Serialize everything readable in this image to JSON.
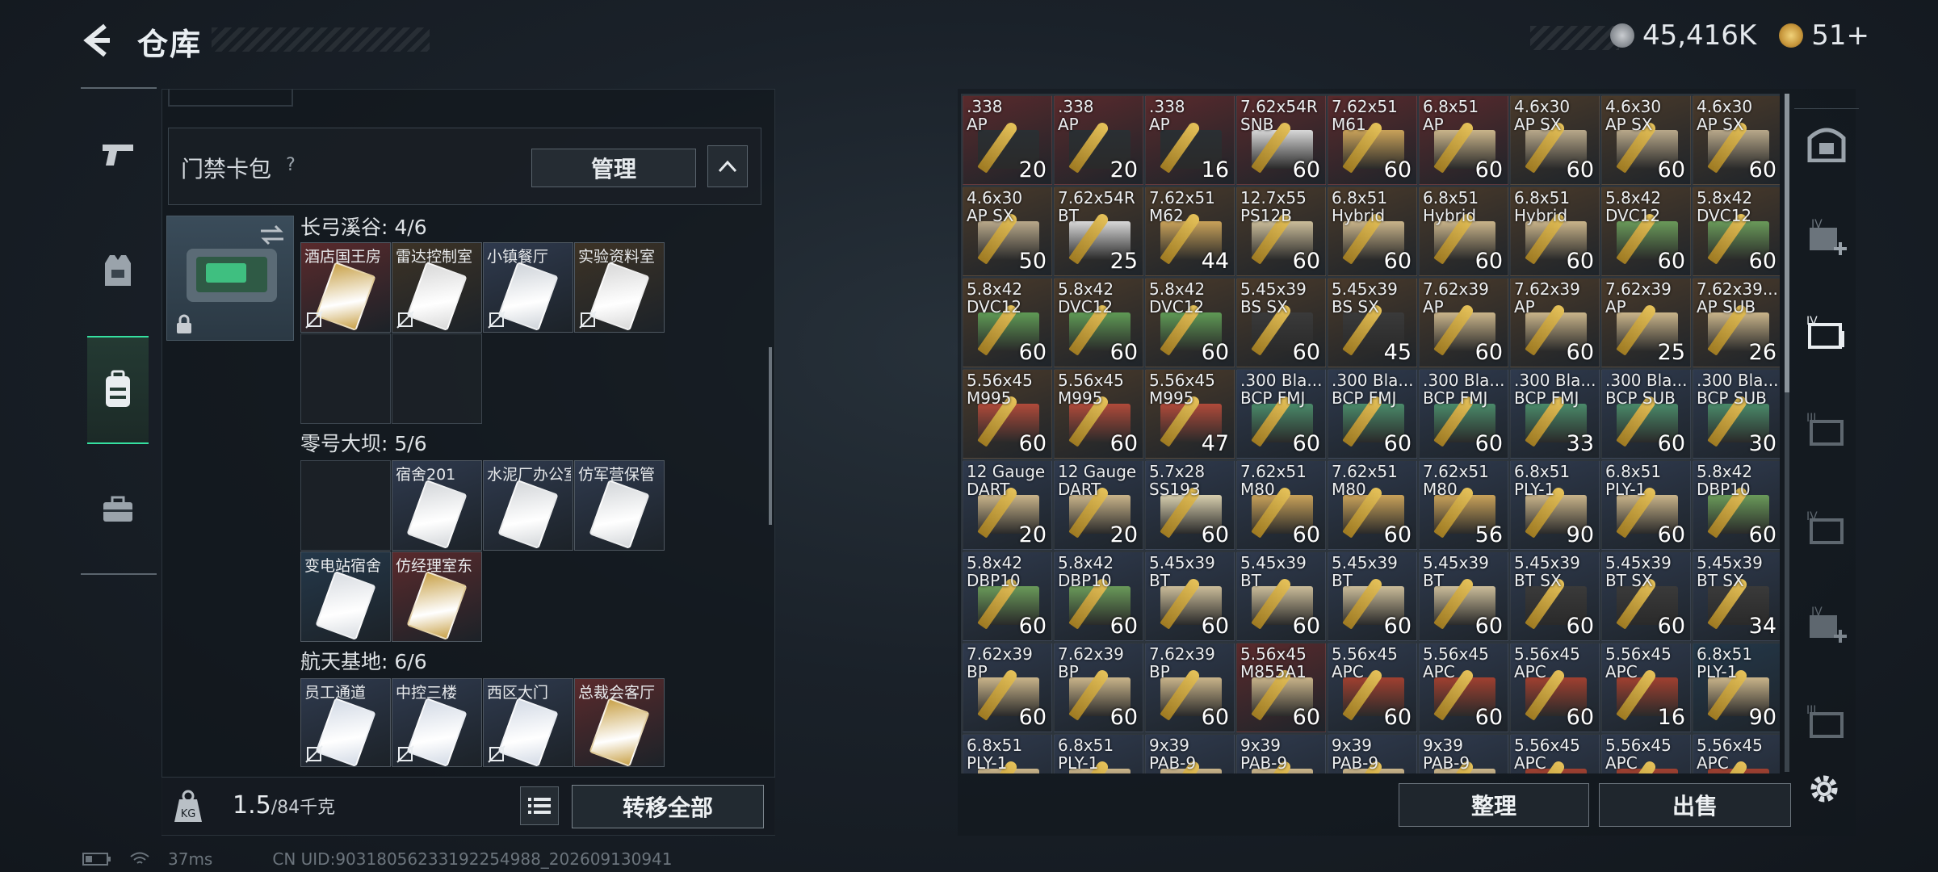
{
  "header": {
    "title": "仓库",
    "currency_silver": "45,416K",
    "currency_gold": "51+"
  },
  "left": {
    "access_label": "门禁卡包",
    "help": "?",
    "manage": "管理",
    "sections": [
      {
        "title": "长弓溪谷: 4/6",
        "keys": [
          {
            "name": "酒店国王房",
            "bg": "#5a2a2c",
            "card": "#c9a24a"
          },
          {
            "name": "雷达控制室",
            "bg": "#3d3326",
            "card": "#d9d9d9"
          },
          {
            "name": "小镇餐厅",
            "bg": "#2f3a4e",
            "card": "#cfd4da"
          },
          {
            "name": "实验资料室",
            "bg": "#3d3326",
            "card": "#d9d9d9"
          }
        ],
        "empty": 2
      },
      {
        "title": "零号大坝: 5/6",
        "keys": [
          {
            "name": "宿舍201",
            "bg": "#2f3a4e",
            "card": "#d4d7da"
          },
          {
            "name": "水泥厂办公室",
            "bg": "#2f3a4e",
            "card": "#d4d7da"
          },
          {
            "name": "仿军营保管",
            "bg": "#2f3a4e",
            "card": "#d4d7da"
          },
          {
            "name": "变电站宿舍",
            "bg": "#24384a",
            "card": "#d9dde2"
          },
          {
            "name": "仿经理室东",
            "bg": "#5a2a2c",
            "card": "#c9a24a"
          }
        ],
        "empty": 1
      },
      {
        "title": "航天基地: 6/6",
        "keys": [
          {
            "name": "员工通道",
            "bg": "#2f3a4e",
            "card": "#d4dbe6"
          },
          {
            "name": "中控三楼",
            "bg": "#2f3a4e",
            "card": "#d4dbe6"
          },
          {
            "name": "西区大门",
            "bg": "#2f3a4e",
            "card": "#d4dbe6"
          },
          {
            "name": "总裁会客厅",
            "bg": "#5a2a2c",
            "card": "#c9a24a"
          }
        ]
      }
    ],
    "weight_value": "1.5",
    "weight_max": "/84千克",
    "transfer_all": "转移全部"
  },
  "right": {
    "sort": "整理",
    "sell": "出售",
    "items": [
      {
        "n": ".338\nAP",
        "c": "20",
        "bg": "#5a2a2c",
        "box": "#2a2f33"
      },
      {
        "n": ".338\nAP",
        "c": "20",
        "bg": "#5a2a2c",
        "box": "#2a2f33"
      },
      {
        "n": ".338\nAP",
        "c": "16",
        "bg": "#5a2a2c",
        "box": "#2a2f33"
      },
      {
        "n": "7.62x54R\nSNB",
        "c": "60",
        "bg": "#5a2a2c",
        "box": "#d8d8d8"
      },
      {
        "n": "7.62x51\nM61",
        "c": "60",
        "bg": "#5a2a2c",
        "box": "#c9a25a"
      },
      {
        "n": "6.8x51\nAP",
        "c": "60",
        "bg": "#5a2a2c",
        "box": "#c9b48a"
      },
      {
        "n": "4.6x30\nAP SX",
        "c": "60",
        "bg": "#4a3a2a",
        "box": "#b8a88a"
      },
      {
        "n": "4.6x30\nAP SX",
        "c": "60",
        "bg": "#4a3a2a",
        "box": "#b8a88a"
      },
      {
        "n": "4.6x30\nAP SX",
        "c": "60",
        "bg": "#4a3a2a",
        "box": "#b8a88a"
      },
      {
        "n": "4.6x30\nAP SX",
        "c": "50",
        "bg": "#4a3a2a",
        "box": "#b8a88a"
      },
      {
        "n": "7.62x54R\nBT",
        "c": "25",
        "bg": "#4a3a2a",
        "box": "#d8d8d8"
      },
      {
        "n": "7.62x51\nM62",
        "c": "44",
        "bg": "#4a3a2a",
        "box": "#c9a25a"
      },
      {
        "n": "12.7x55\nPS12B",
        "c": "60",
        "bg": "#4a3a2a",
        "box": "#cbbd9a"
      },
      {
        "n": "6.8x51\nHybrid",
        "c": "60",
        "bg": "#4a3a2a",
        "box": "#c9b48a"
      },
      {
        "n": "6.8x51\nHybrid",
        "c": "60",
        "bg": "#4a3a2a",
        "box": "#c9b48a"
      },
      {
        "n": "6.8x51\nHybrid",
        "c": "60",
        "bg": "#4a3a2a",
        "box": "#c9b48a"
      },
      {
        "n": "5.8x42\nDVC12",
        "c": "60",
        "bg": "#4a3a2a",
        "box": "#6a9a5a"
      },
      {
        "n": "5.8x42\nDVC12",
        "c": "60",
        "bg": "#4a3a2a",
        "box": "#6a9a5a"
      },
      {
        "n": "5.8x42\nDVC12",
        "c": "60",
        "bg": "#4a3a2a",
        "box": "#5f9a55"
      },
      {
        "n": "5.8x42\nDVC12",
        "c": "60",
        "bg": "#4a3a2a",
        "box": "#5f9a55"
      },
      {
        "n": "5.8x42\nDVC12",
        "c": "60",
        "bg": "#4a3a2a",
        "box": "#5f9a55"
      },
      {
        "n": "5.45x39\nBS SX",
        "c": "60",
        "bg": "#4a3a2a",
        "box": "#3a3a3a"
      },
      {
        "n": "5.45x39\nBS SX",
        "c": "45",
        "bg": "#4a3a2a",
        "box": "#3a3a3a"
      },
      {
        "n": "7.62x39\nAP",
        "c": "60",
        "bg": "#4a3a2a",
        "box": "#c9b48a"
      },
      {
        "n": "7.62x39\nAP",
        "c": "60",
        "bg": "#4a3a2a",
        "box": "#c9b48a"
      },
      {
        "n": "7.62x39\nAP",
        "c": "25",
        "bg": "#4a3a2a",
        "box": "#c9b48a"
      },
      {
        "n": "7.62x39...\nAP SUB",
        "c": "26",
        "bg": "#4a3a2a",
        "box": "#c9b48a"
      },
      {
        "n": "5.56x45\nM995",
        "c": "60",
        "bg": "#4a3a2a",
        "box": "#b04a3a"
      },
      {
        "n": "5.56x45\nM995",
        "c": "60",
        "bg": "#4a3a2a",
        "box": "#b04a3a"
      },
      {
        "n": "5.56x45\nM995",
        "c": "47",
        "bg": "#4a3a2a",
        "box": "#b04a3a"
      },
      {
        "n": ".300 Bla...\nBCP FMJ",
        "c": "60",
        "bg": "#2f3a4e",
        "box": "#4a8a6a"
      },
      {
        "n": ".300 Bla...\nBCP FMJ",
        "c": "60",
        "bg": "#2f3a4e",
        "box": "#4a8a6a"
      },
      {
        "n": ".300 Bla...\nBCP FMJ",
        "c": "60",
        "bg": "#2f3a4e",
        "box": "#4a8a6a"
      },
      {
        "n": ".300 Bla...\nBCP FMJ",
        "c": "33",
        "bg": "#2f3a4e",
        "box": "#4a8a6a"
      },
      {
        "n": ".300 Bla...\nBCP SUB",
        "c": "60",
        "bg": "#2f3a4e",
        "box": "#4a8a6a"
      },
      {
        "n": ".300 Bla...\nBCP SUB",
        "c": "30",
        "bg": "#2f3a4e",
        "box": "#4a8a6a"
      },
      {
        "n": "12 Gauge\nDART",
        "c": "20",
        "bg": "#2f3a4e",
        "box": "#c9b48a"
      },
      {
        "n": "12 Gauge\nDART",
        "c": "20",
        "bg": "#2f3a4e",
        "box": "#c9b48a"
      },
      {
        "n": "5.7x28\nSS193",
        "c": "60",
        "bg": "#2f3a4e",
        "box": "#d8cfae"
      },
      {
        "n": "7.62x51\nM80",
        "c": "60",
        "bg": "#2f3a4e",
        "box": "#c9a25a"
      },
      {
        "n": "7.62x51\nM80",
        "c": "60",
        "bg": "#2f3a4e",
        "box": "#c9a25a"
      },
      {
        "n": "7.62x51\nM80",
        "c": "56",
        "bg": "#2f3a4e",
        "box": "#c9a25a"
      },
      {
        "n": "6.8x51\nPLY-1",
        "c": "90",
        "bg": "#2f3a4e",
        "box": "#c9b48a"
      },
      {
        "n": "6.8x51\nPLY-1",
        "c": "60",
        "bg": "#2f3a4e",
        "box": "#c9b48a"
      },
      {
        "n": "5.8x42\nDBP10",
        "c": "60",
        "bg": "#2f3a4e",
        "box": "#6a9a5a"
      },
      {
        "n": "5.8x42\nDBP10",
        "c": "60",
        "bg": "#2f3a4e",
        "box": "#6a9a5a"
      },
      {
        "n": "5.8x42\nDBP10",
        "c": "60",
        "bg": "#2f3a4e",
        "box": "#6a9a5a"
      },
      {
        "n": "5.45x39\nBT",
        "c": "60",
        "bg": "#2f3a4e",
        "box": "#cbbd9a"
      },
      {
        "n": "5.45x39\nBT",
        "c": "60",
        "bg": "#2f3a4e",
        "box": "#cbbd9a"
      },
      {
        "n": "5.45x39\nBT",
        "c": "60",
        "bg": "#2f3a4e",
        "box": "#cbbd9a"
      },
      {
        "n": "5.45x39\nBT",
        "c": "60",
        "bg": "#2f3a4e",
        "box": "#cbbd9a"
      },
      {
        "n": "5.45x39\nBT SX",
        "c": "60",
        "bg": "#2f3a4e",
        "box": "#3a3a3a"
      },
      {
        "n": "5.45x39\nBT SX",
        "c": "60",
        "bg": "#2f3a4e",
        "box": "#3a3a3a"
      },
      {
        "n": "5.45x39\nBT SX",
        "c": "34",
        "bg": "#2f3a4e",
        "box": "#3a3a3a"
      },
      {
        "n": "7.62x39\nBP",
        "c": "60",
        "bg": "#2f3a4e",
        "box": "#c9b48a"
      },
      {
        "n": "7.62x39\nBP",
        "c": "60",
        "bg": "#2f3a4e",
        "box": "#c9b48a"
      },
      {
        "n": "7.62x39\nBP",
        "c": "60",
        "bg": "#2f3a4e",
        "box": "#c9b48a"
      },
      {
        "n": "5.56x45\nM855A1",
        "c": "60",
        "bg": "#5a2a2c",
        "box": "#c9b48a"
      },
      {
        "n": "5.56x45\nAPC",
        "c": "60",
        "bg": "#2f3a4e",
        "box": "#a04030"
      },
      {
        "n": "5.56x45\nAPC",
        "c": "60",
        "bg": "#2f3a4e",
        "box": "#a04030"
      },
      {
        "n": "5.56x45\nAPC",
        "c": "60",
        "bg": "#2f3a4e",
        "box": "#a04030"
      },
      {
        "n": "5.56x45\nAPC",
        "c": "16",
        "bg": "#2f3a4e",
        "box": "#a04030"
      },
      {
        "n": "6.8x51\nPLY-1",
        "c": "90",
        "bg": "#24384a",
        "box": "#c9b48a"
      },
      {
        "n": "6.8x51\nPLY-1",
        "c": "",
        "bg": "#2f3a4e",
        "box": "#c9b48a"
      },
      {
        "n": "6.8x51\nPLY-1",
        "c": "",
        "bg": "#2f3a4e",
        "box": "#c9b48a"
      },
      {
        "n": "9x39\nPAB-9",
        "c": "",
        "bg": "#2f3a4e",
        "box": "#c9b48a"
      },
      {
        "n": "9x39\nPAB-9",
        "c": "",
        "bg": "#2f3a4e",
        "box": "#c9b48a"
      },
      {
        "n": "9x39\nPAB-9",
        "c": "",
        "bg": "#2f3a4e",
        "box": "#c9b48a"
      },
      {
        "n": "9x39\nPAB-9",
        "c": "",
        "bg": "#2f3a4e",
        "box": "#c9b48a"
      },
      {
        "n": "5.56x45\nAPC",
        "c": "",
        "bg": "#2f3a4e",
        "box": "#a04030"
      },
      {
        "n": "5.56x45\nAPC",
        "c": "",
        "bg": "#2f3a4e",
        "box": "#a04030"
      },
      {
        "n": "5.56x45\nAPC",
        "c": "",
        "bg": "#2f3a4e",
        "box": "#a04030"
      }
    ]
  },
  "status": {
    "ping": "37ms",
    "uid": "CN UID:903180562331922549​88_202609130941"
  }
}
